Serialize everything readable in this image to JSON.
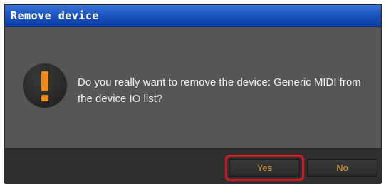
{
  "dialog": {
    "title": "Remove device",
    "message": "Do you really want to remove the device: Generic MIDI from the device IO list?",
    "icon": "warning-exclamation-icon",
    "accent_color": "#f08a1c"
  },
  "buttons": {
    "yes_label": "Yes",
    "no_label": "No",
    "label_color": "#e0a030"
  },
  "annotation": {
    "highlight_target": "yes-button",
    "highlight_color": "#d61a24"
  }
}
